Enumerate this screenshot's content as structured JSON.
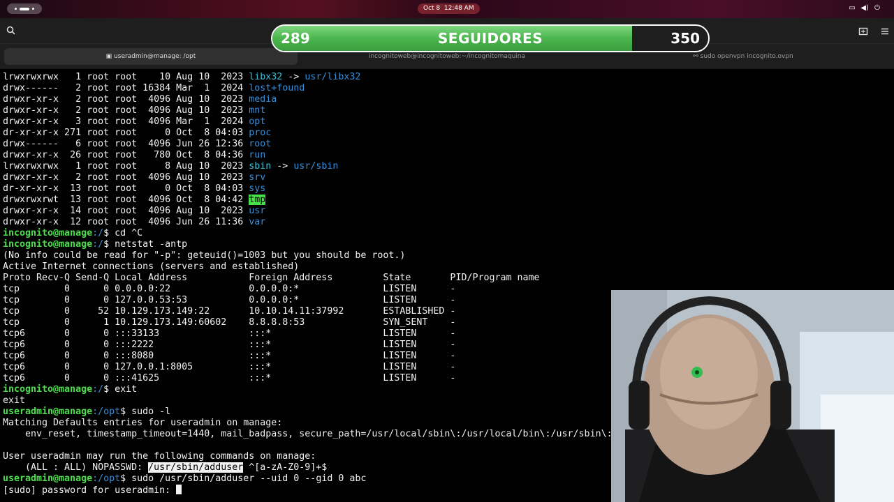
{
  "clock": "Oct 8  12:48 AM",
  "followers": {
    "current": "289",
    "label": "SEGUIDORES",
    "goal": "350",
    "progress": 0.826
  },
  "tabs": [
    {
      "label": "useradmin@manage: /opt",
      "active": true
    },
    {
      "label": "incognitoweb@incognitoweb:~/incognitomaquina",
      "active": false
    },
    {
      "label": "sudo openvpn incognito.ovpn",
      "active": false
    }
  ],
  "terminal": {
    "lines": [
      {
        "p": [
          "lrwxrwxrwx   1 root root    10 Aug 10  2023 ",
          "libx32",
          " -> ",
          "usr/libx32"
        ]
      },
      {
        "p": [
          "drwx------   2 root root 16384 Mar  1  2024 ",
          "lost+found"
        ]
      },
      {
        "p": [
          "drwxr-xr-x   2 root root  4096 Aug 10  2023 ",
          "media"
        ]
      },
      {
        "p": [
          "drwxr-xr-x   2 root root  4096 Aug 10  2023 ",
          "mnt"
        ]
      },
      {
        "p": [
          "drwxr-xr-x   3 root root  4096 Mar  1  2024 ",
          "opt"
        ]
      },
      {
        "p": [
          "dr-xr-xr-x 271 root root     0 Oct  8 04:03 ",
          "proc"
        ]
      },
      {
        "p": [
          "drwx------   6 root root  4096 Jun 26 12:36 ",
          "root"
        ]
      },
      {
        "p": [
          "drwxr-xr-x  26 root root   780 Oct  8 04:36 ",
          "run"
        ]
      },
      {
        "p": [
          "lrwxrwxrwx   1 root root     8 Aug 10  2023 ",
          "sbin",
          " -> ",
          "usr/sbin"
        ]
      },
      {
        "p": [
          "drwxr-xr-x   2 root root  4096 Aug 10  2023 ",
          "srv"
        ]
      },
      {
        "p": [
          "dr-xr-xr-x  13 root root     0 Oct  8 04:03 ",
          "sys"
        ]
      },
      {
        "p": [
          "drwxrwxrwt  13 root root  4096 Oct  8 04:42 ",
          "tmp"
        ]
      },
      {
        "p": [
          "drwxr-xr-x  14 root root  4096 Aug 10  2023 ",
          "usr"
        ]
      },
      {
        "p": [
          "drwxr-xr-x  12 root root  4096 Jun 26 11:36 ",
          "var"
        ]
      },
      {
        "p": [
          "incognito@manage",
          ":/",
          "$ cd ^C"
        ]
      },
      {
        "p": [
          "incognito@manage",
          ":/",
          "$ netstat -antp"
        ]
      },
      {
        "p": [
          "(No info could be read for \"-p\": geteuid()=1003 but you should be root.)"
        ]
      },
      {
        "p": [
          "Active Internet connections (servers and established)"
        ]
      },
      {
        "p": [
          "Proto Recv-Q Send-Q Local Address           Foreign Address         State       PID/Program name"
        ]
      },
      {
        "p": [
          "tcp        0      0 0.0.0.0:22              0.0.0.0:*               LISTEN      -"
        ]
      },
      {
        "p": [
          "tcp        0      0 127.0.0.53:53           0.0.0.0:*               LISTEN      -"
        ]
      },
      {
        "p": [
          "tcp        0     52 10.129.173.149:22       10.10.14.11:37992       ESTABLISHED -"
        ]
      },
      {
        "p": [
          "tcp        0      1 10.129.173.149:60602    8.8.8.8:53              SYN_SENT    -"
        ]
      },
      {
        "p": [
          "tcp6       0      0 :::33133                :::*                    LISTEN      -"
        ]
      },
      {
        "p": [
          "tcp6       0      0 :::2222                 :::*                    LISTEN      -"
        ]
      },
      {
        "p": [
          "tcp6       0      0 :::8080                 :::*                    LISTEN      -"
        ]
      },
      {
        "p": [
          "tcp6       0      0 127.0.0.1:8005          :::*                    LISTEN      -"
        ]
      },
      {
        "p": [
          "tcp6       0      0 :::41625                :::*                    LISTEN      -"
        ]
      },
      {
        "p": [
          "incognito@manage",
          ":/",
          "$ exit"
        ]
      },
      {
        "p": [
          "exit"
        ]
      },
      {
        "p": [
          "useradmin@manage",
          ":/opt",
          "$ sudo -l"
        ]
      },
      {
        "p": [
          "Matching Defaults entries for useradmin on manage:"
        ]
      },
      {
        "p": [
          "    env_reset, timestamp_timeout=1440, mail_badpass, secure_path=/usr/local/sbin\\:/usr/local/bin\\:/usr/sbin\\:"
        ]
      },
      {
        "p": [
          ""
        ]
      },
      {
        "p": [
          "User useradmin may run the following commands on manage:"
        ]
      },
      {
        "p": [
          "    (ALL : ALL) NOPASSWD: ",
          "/usr/sbin/adduser",
          " ^[a-zA-Z0-9]+$"
        ]
      },
      {
        "p": [
          "useradmin@manage",
          ":/opt",
          "$ sudo /usr/sbin/adduser --uid 0 --gid 0 abc"
        ]
      },
      {
        "p": [
          "[sudo] password for useradmin: "
        ]
      }
    ]
  }
}
